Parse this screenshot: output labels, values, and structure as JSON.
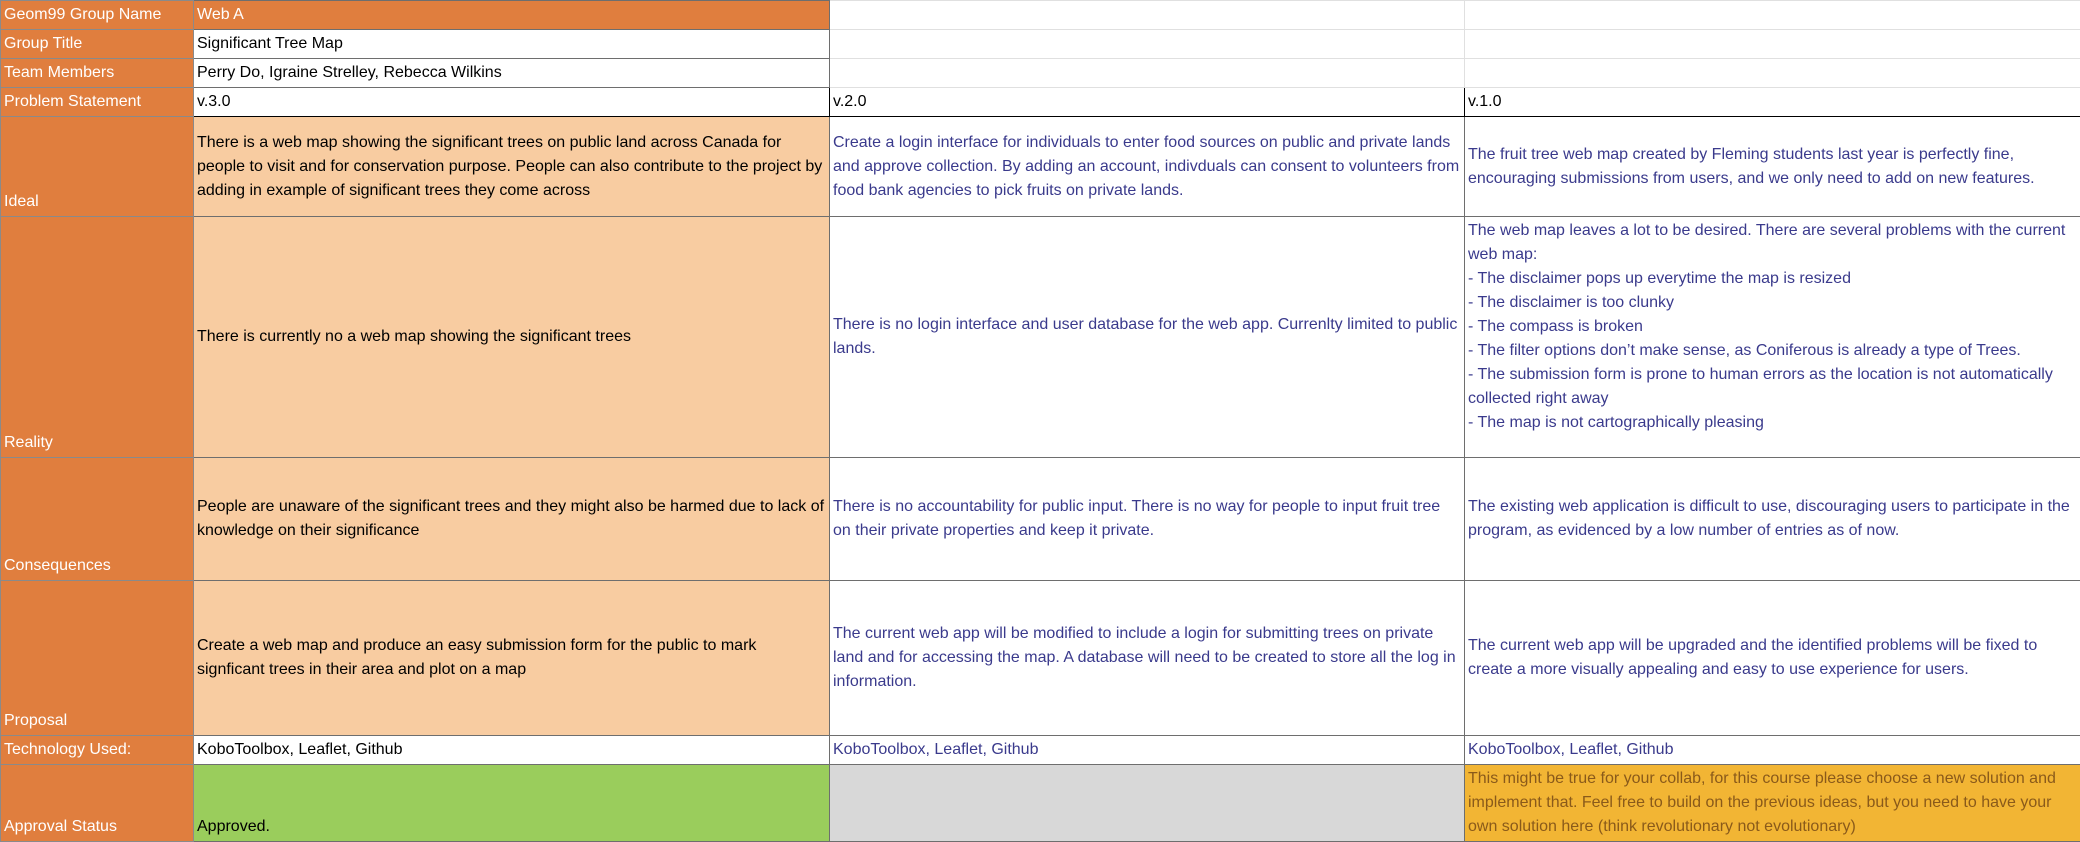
{
  "sheet": {
    "rows": {
      "group_name": {
        "label": "Geom99 Group Name",
        "v3": "Web A"
      },
      "group_title": {
        "label": "Group Title",
        "v3": "Significant Tree Map"
      },
      "team_members": {
        "label": "Team Members",
        "v3": "Perry Do, Igraine Strelley, Rebecca Wilkins"
      },
      "problem_statement": {
        "label": "Problem Statement",
        "v3": "v.3.0",
        "v2": "v.2.0",
        "v1": "v.1.0"
      },
      "ideal": {
        "label": "Ideal",
        "v3": "There is a web map showing the significant trees on public land across Canada for people to visit and for conservation purpose. People can also contribute to the project by adding in example of significant trees they come across",
        "v2": "Create a login interface for individuals to enter food sources on public and private lands and approve collection. By adding an account, indivduals can consent to volunteers from food bank agencies to pick fruits on private lands.",
        "v1": "The fruit tree web map created by Fleming students last year is perfectly fine, encouraging submissions from users, and we only need to add on new features."
      },
      "reality": {
        "label": "Reality",
        "v3": "There is currently no a web map showing the significant trees",
        "v2": "There is no login interface and user database for the web app. Currenlty limited to public lands.",
        "v1": "The web map leaves a lot to be desired. There are several problems with the current web map:\n- The disclaimer pops up everytime the map is resized\n- The disclaimer is too clunky\n- The compass is broken\n- The filter options don’t make sense, as Coniferous is already a type of Trees.\n- The submission form is prone to human errors as the location is not automatically collected right away\n- The map is not cartographically pleasing"
      },
      "consequences": {
        "label": "Consequences",
        "v3": "People are unaware of the significant trees and they might also be harmed due to lack of knowledge on their significance",
        "v2": "There is no accountability for public input. There is no way for people to input fruit tree on their private properties and keep it private.",
        "v1": "The existing web application is difficult to use, discouraging users to participate in the program, as evidenced by a low number of entries as of now."
      },
      "proposal": {
        "label": "Proposal",
        "v3": "Create a web map and produce an easy submission form for the public to mark signficant trees in their area and plot on a map",
        "v2": "The current web app will be modified to include a login for submitting trees on private land and for accessing the map. A database will need to be created to store all the log in information.",
        "v1": "The current web app will be upgraded and the identified problems will be fixed to create a more visually appealing and easy to use experience for users."
      },
      "technology": {
        "label": "Technology Used:",
        "v3": "KoboToolbox, Leaflet, Github",
        "v2": "KoboToolbox, Leaflet, Github",
        "v1": "KoboToolbox, Leaflet, Github"
      },
      "approval": {
        "label": "Approval Status",
        "v3": "Approved.",
        "v2": "",
        "v1": "This might be true for your collab, for this course please choose a new solution and implement that. Feel free to build on the previous ideas, but you need to have your own solution here (think revolutionary not evolutionary)"
      }
    }
  }
}
